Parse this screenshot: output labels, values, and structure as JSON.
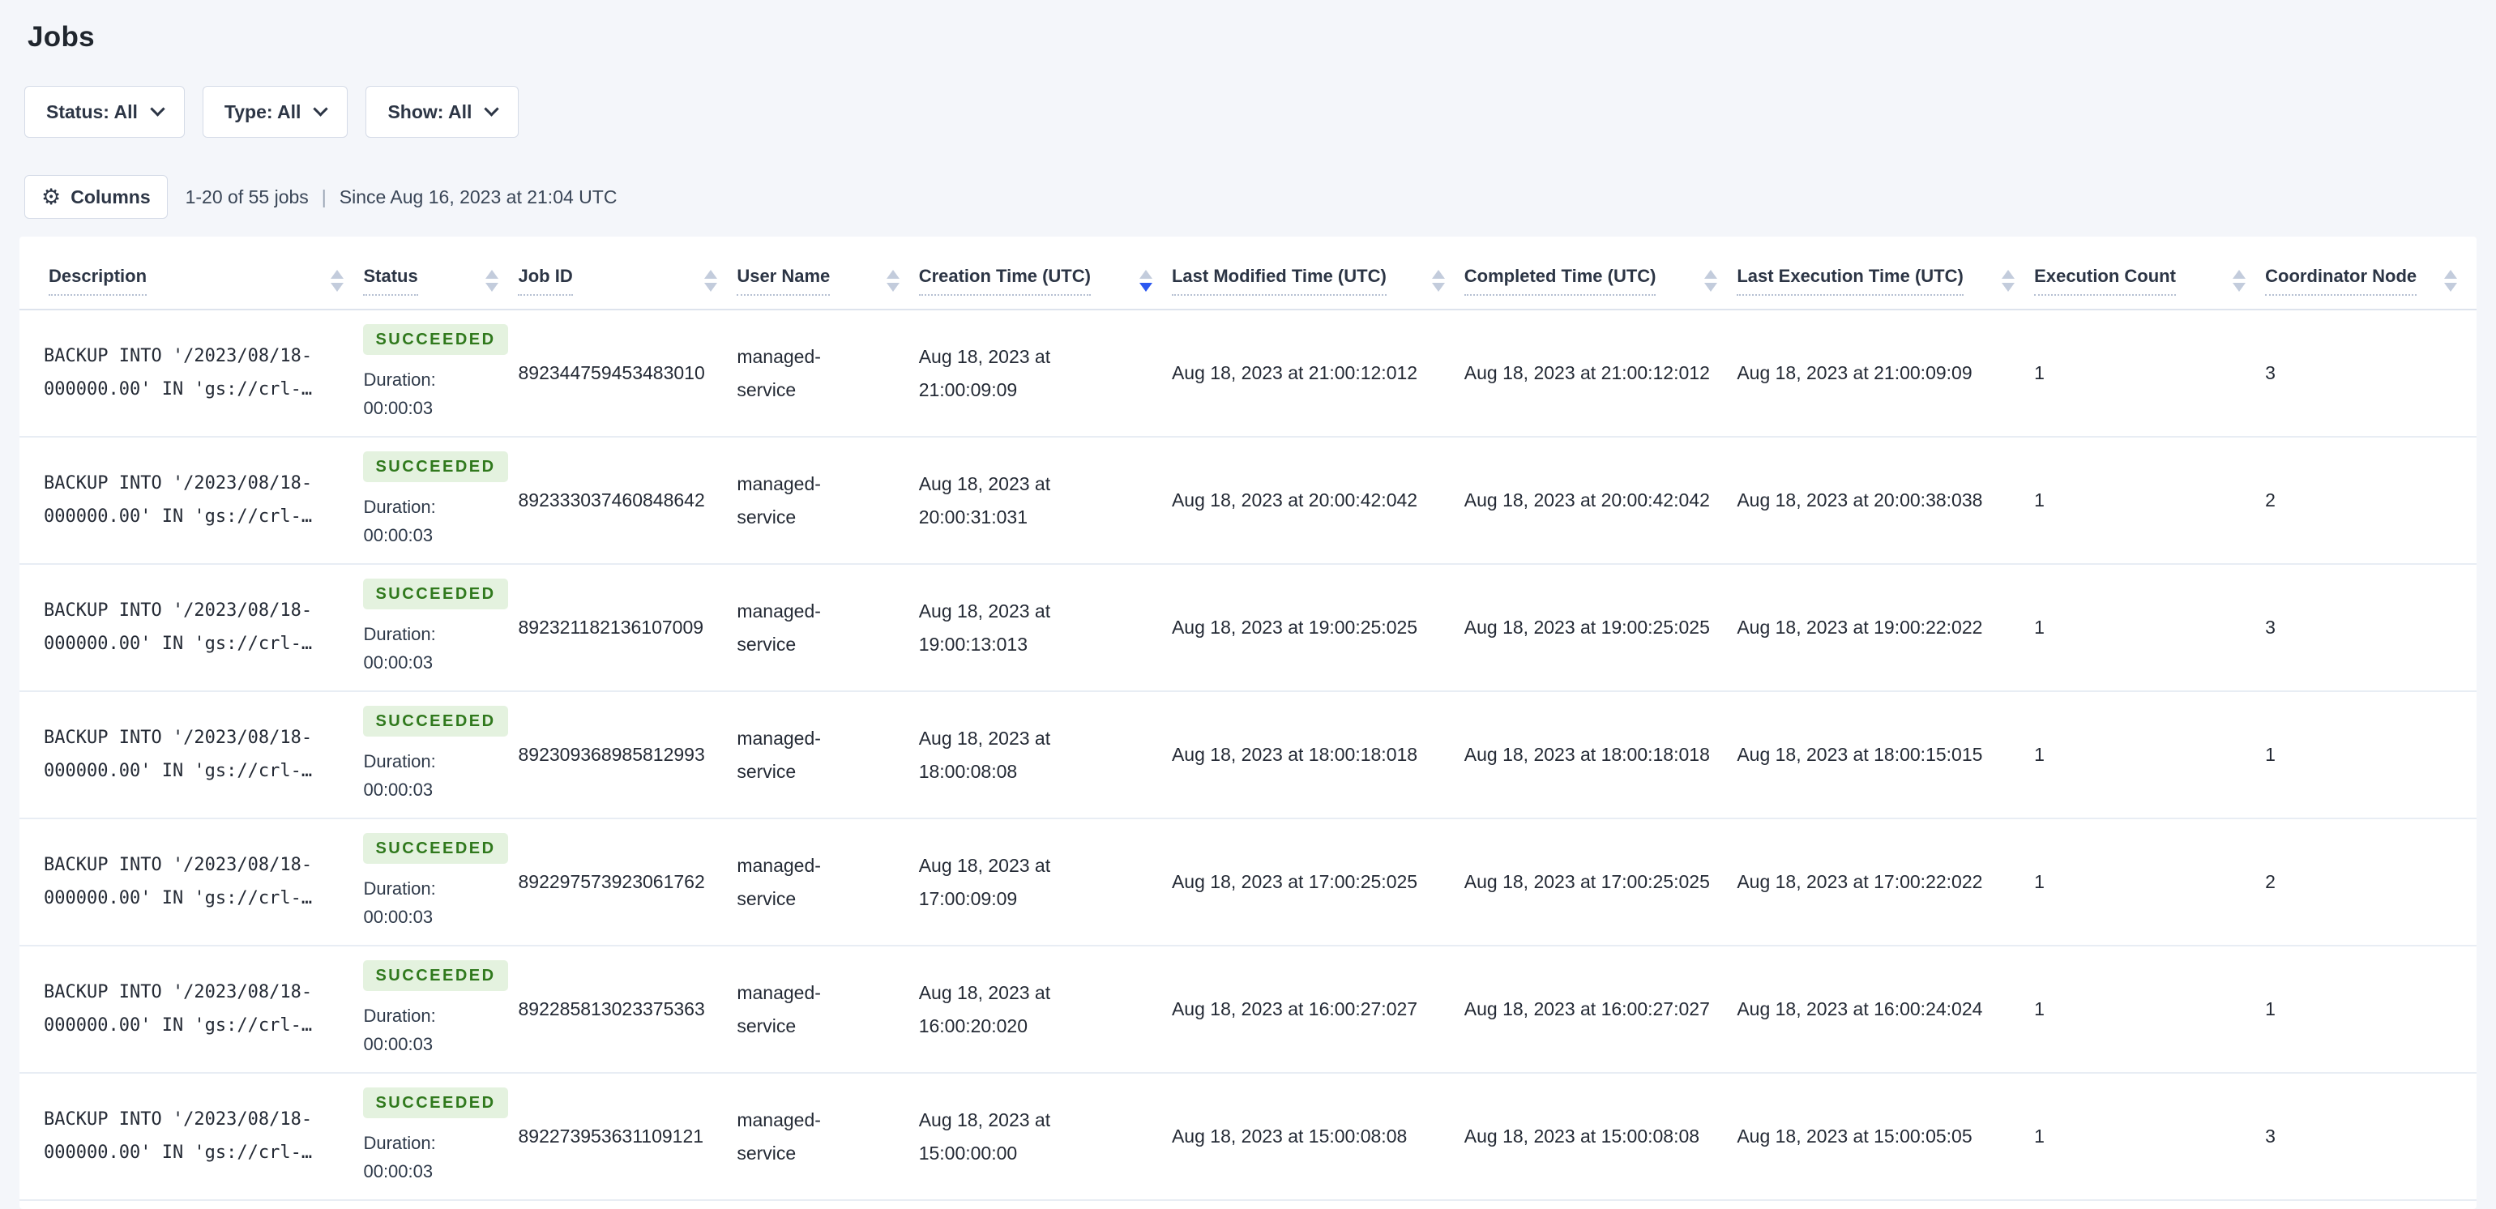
{
  "page": {
    "title": "Jobs"
  },
  "filters": [
    {
      "label": "Status: All"
    },
    {
      "label": "Type: All"
    },
    {
      "label": "Show: All"
    }
  ],
  "toolbar": {
    "columns_label": "Columns",
    "gear_icon": "⚙",
    "count_text": "1-20 of 55 jobs",
    "separator": "|",
    "since_text": "Since Aug 16, 2023 at 21:04 UTC"
  },
  "table": {
    "columns": [
      {
        "label": "Description"
      },
      {
        "label": "Status"
      },
      {
        "label": "Job ID"
      },
      {
        "label": "User Name"
      },
      {
        "label": "Creation Time (UTC)"
      },
      {
        "label": "Last Modified Time (UTC)"
      },
      {
        "label": "Completed Time (UTC)"
      },
      {
        "label": "Last Execution Time (UTC)"
      },
      {
        "label": "Execution Count"
      },
      {
        "label": "Coordinator Node"
      }
    ],
    "sort": {
      "active_column": 4,
      "direction": "desc"
    },
    "rows": [
      {
        "description_line1": "BACKUP INTO '/2023/08/18-",
        "description_line2": "000000.00' IN 'gs://crl-…",
        "status": "SUCCEEDED",
        "duration_label": "Duration:",
        "duration": "00:00:03",
        "job_id": "892344759453483010",
        "user_name": "managed-service",
        "creation_time": "Aug 18, 2023 at 21:00:09:09",
        "last_modified_time": "Aug 18, 2023 at 21:00:12:012",
        "completed_time": "Aug 18, 2023 at 21:00:12:012",
        "last_execution_time": "Aug 18, 2023 at 21:00:09:09",
        "execution_count": "1",
        "coordinator_node": "3"
      },
      {
        "description_line1": "BACKUP INTO '/2023/08/18-",
        "description_line2": "000000.00' IN 'gs://crl-…",
        "status": "SUCCEEDED",
        "duration_label": "Duration:",
        "duration": "00:00:03",
        "job_id": "892333037460848642",
        "user_name": "managed-service",
        "creation_time": "Aug 18, 2023 at 20:00:31:031",
        "last_modified_time": "Aug 18, 2023 at 20:00:42:042",
        "completed_time": "Aug 18, 2023 at 20:00:42:042",
        "last_execution_time": "Aug 18, 2023 at 20:00:38:038",
        "execution_count": "1",
        "coordinator_node": "2"
      },
      {
        "description_line1": "BACKUP INTO '/2023/08/18-",
        "description_line2": "000000.00' IN 'gs://crl-…",
        "status": "SUCCEEDED",
        "duration_label": "Duration:",
        "duration": "00:00:03",
        "job_id": "892321182136107009",
        "user_name": "managed-service",
        "creation_time": "Aug 18, 2023 at 19:00:13:013",
        "last_modified_time": "Aug 18, 2023 at 19:00:25:025",
        "completed_time": "Aug 18, 2023 at 19:00:25:025",
        "last_execution_time": "Aug 18, 2023 at 19:00:22:022",
        "execution_count": "1",
        "coordinator_node": "3"
      },
      {
        "description_line1": "BACKUP INTO '/2023/08/18-",
        "description_line2": "000000.00' IN 'gs://crl-…",
        "status": "SUCCEEDED",
        "duration_label": "Duration:",
        "duration": "00:00:03",
        "job_id": "892309368985812993",
        "user_name": "managed-service",
        "creation_time": "Aug 18, 2023 at 18:00:08:08",
        "last_modified_time": "Aug 18, 2023 at 18:00:18:018",
        "completed_time": "Aug 18, 2023 at 18:00:18:018",
        "last_execution_time": "Aug 18, 2023 at 18:00:15:015",
        "execution_count": "1",
        "coordinator_node": "1"
      },
      {
        "description_line1": "BACKUP INTO '/2023/08/18-",
        "description_line2": "000000.00' IN 'gs://crl-…",
        "status": "SUCCEEDED",
        "duration_label": "Duration:",
        "duration": "00:00:03",
        "job_id": "892297573923061762",
        "user_name": "managed-service",
        "creation_time": "Aug 18, 2023 at 17:00:09:09",
        "last_modified_time": "Aug 18, 2023 at 17:00:25:025",
        "completed_time": "Aug 18, 2023 at 17:00:25:025",
        "last_execution_time": "Aug 18, 2023 at 17:00:22:022",
        "execution_count": "1",
        "coordinator_node": "2"
      },
      {
        "description_line1": "BACKUP INTO '/2023/08/18-",
        "description_line2": "000000.00' IN 'gs://crl-…",
        "status": "SUCCEEDED",
        "duration_label": "Duration:",
        "duration": "00:00:03",
        "job_id": "892285813023375363",
        "user_name": "managed-service",
        "creation_time": "Aug 18, 2023 at 16:00:20:020",
        "last_modified_time": "Aug 18, 2023 at 16:00:27:027",
        "completed_time": "Aug 18, 2023 at 16:00:27:027",
        "last_execution_time": "Aug 18, 2023 at 16:00:24:024",
        "execution_count": "1",
        "coordinator_node": "1"
      },
      {
        "description_line1": "BACKUP INTO '/2023/08/18-",
        "description_line2": "000000.00' IN 'gs://crl-…",
        "status": "SUCCEEDED",
        "duration_label": "Duration:",
        "duration": "00:00:03",
        "job_id": "892273953631109121",
        "user_name": "managed-service",
        "creation_time": "Aug 18, 2023 at 15:00:00:00",
        "last_modified_time": "Aug 18, 2023 at 15:00:08:08",
        "completed_time": "Aug 18, 2023 at 15:00:08:08",
        "last_execution_time": "Aug 18, 2023 at 15:00:05:05",
        "execution_count": "1",
        "coordinator_node": "3"
      }
    ]
  },
  "colors": {
    "page_bg": "#f4f6fa",
    "card_bg": "#ffffff",
    "text_primary": "#242a35",
    "text_secondary": "#3a4657",
    "border": "#d5dbe7",
    "row_border": "#e8edf4",
    "badge_bg": "#e4f2df",
    "badge_text": "#30791d",
    "sort_active": "#2b57f0",
    "sort_inactive": "#c3ccdc",
    "dotted_underline": "#b6c0d2"
  }
}
